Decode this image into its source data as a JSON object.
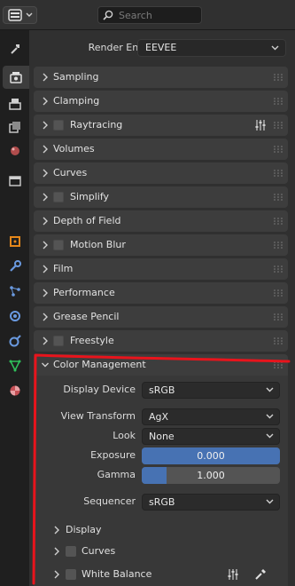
{
  "header": {
    "search": {
      "placeholder": "Search"
    }
  },
  "tabs": [
    {
      "name": "tool",
      "icon": "tool-icon"
    },
    {
      "name": "render",
      "icon": "render-icon",
      "active": true
    },
    {
      "name": "output",
      "icon": "output-icon"
    },
    {
      "name": "view-layer",
      "icon": "view-layer-icon"
    },
    {
      "name": "scene",
      "icon": "scene-icon"
    },
    {
      "name": "world",
      "icon": "world-icon"
    },
    {
      "name": "object",
      "icon": "object-icon"
    },
    {
      "name": "modifiers",
      "icon": "wrench-icon"
    },
    {
      "name": "particles",
      "icon": "particles-icon"
    },
    {
      "name": "physics",
      "icon": "physics-icon"
    },
    {
      "name": "constraints",
      "icon": "constraints-icon"
    },
    {
      "name": "data",
      "icon": "mesh-data-icon"
    },
    {
      "name": "material",
      "icon": "material-icon"
    }
  ],
  "render_engine": {
    "label": "Render Engine",
    "value": "EEVEE"
  },
  "panels": [
    {
      "label": "Sampling",
      "checkbox": false
    },
    {
      "label": "Clamping",
      "checkbox": false
    },
    {
      "label": "Raytracing",
      "checkbox": true,
      "extra_icon": "settings-sliders-icon"
    },
    {
      "label": "Volumes",
      "checkbox": false
    },
    {
      "label": "Curves",
      "checkbox": false
    },
    {
      "label": "Simplify",
      "checkbox": true
    },
    {
      "label": "Depth of Field",
      "checkbox": false
    },
    {
      "label": "Motion Blur",
      "checkbox": true
    },
    {
      "label": "Film",
      "checkbox": false
    },
    {
      "label": "Performance",
      "checkbox": false
    },
    {
      "label": "Grease Pencil",
      "checkbox": false
    },
    {
      "label": "Freestyle",
      "checkbox": true
    }
  ],
  "color_management": {
    "label": "Color Management",
    "display_device": {
      "label": "Display Device",
      "value": "sRGB"
    },
    "view_transform": {
      "label": "View Transform",
      "value": "AgX"
    },
    "look": {
      "label": "Look",
      "value": "None"
    },
    "exposure": {
      "label": "Exposure",
      "value": "0.000",
      "fill": 1.0
    },
    "gamma": {
      "label": "Gamma",
      "value": "1.000",
      "fill": 0.18
    },
    "sequencer": {
      "label": "Sequencer",
      "value": "sRGB"
    },
    "subpanels": [
      {
        "label": "Display",
        "checkbox": false
      },
      {
        "label": "Curves",
        "checkbox": true
      },
      {
        "label": "White Balance",
        "checkbox": true
      }
    ]
  },
  "colors": {
    "annotation": "#e8141c",
    "accent": "#4772b3"
  }
}
